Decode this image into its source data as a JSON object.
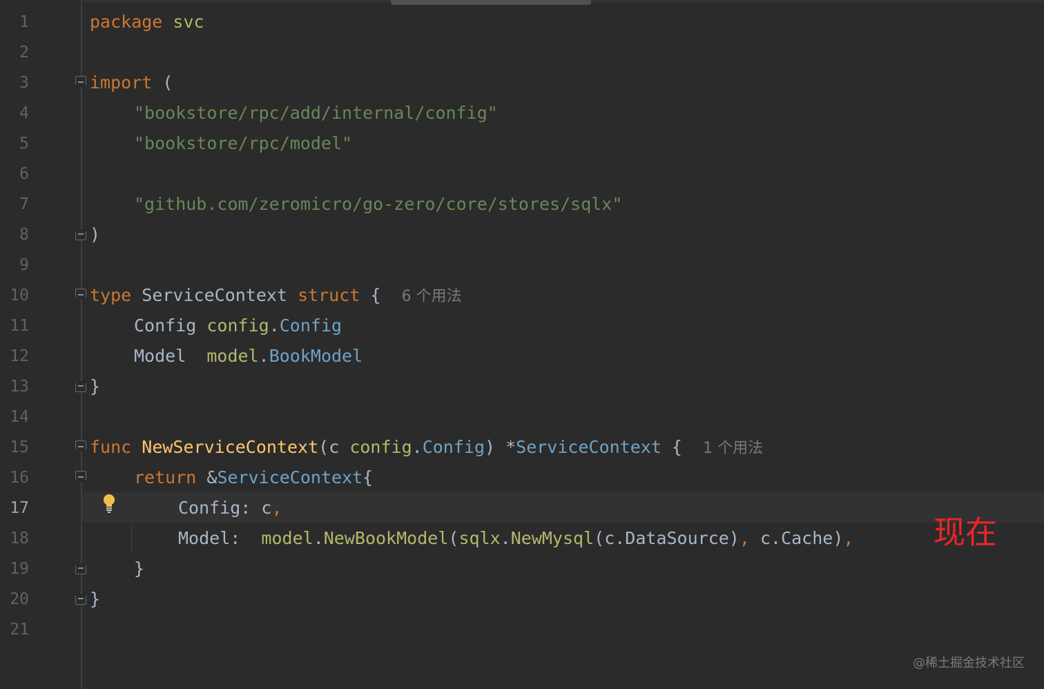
{
  "editor": {
    "line_numbers": [
      "1",
      "2",
      "3",
      "4",
      "5",
      "6",
      "7",
      "8",
      "9",
      "10",
      "11",
      "12",
      "13",
      "14",
      "15",
      "16",
      "17",
      "18",
      "19",
      "20",
      "21"
    ],
    "current_line": "17",
    "code": {
      "l1": {
        "kw": "package",
        "name": "svc"
      },
      "l3": {
        "kw": "import",
        "paren": "("
      },
      "l4": {
        "str": "\"bookstore/rpc/add/internal/config\""
      },
      "l5": {
        "str": "\"bookstore/rpc/model\""
      },
      "l7": {
        "str": "\"github.com/zeromicro/go-zero/core/stores/sqlx\""
      },
      "l8": {
        "paren": ")"
      },
      "l10": {
        "kw": "type",
        "name": "ServiceContext",
        "kw2": "struct",
        "brace": "{",
        "hint": "6 个用法"
      },
      "l11": {
        "field": "Config",
        "pkg": "config",
        "dot": ".",
        "type": "Config"
      },
      "l12": {
        "field": "Model ",
        "pkg": "model",
        "dot": ".",
        "type": "BookModel"
      },
      "l13": {
        "brace": "}"
      },
      "l15": {
        "kw": "func",
        "name": "NewServiceContext",
        "param": "(c ",
        "pkg": "config",
        "dot": ".",
        "type": "Config",
        "close": ") *",
        "ret": "ServiceContext",
        "brace": " {",
        "hint": "1 个用法"
      },
      "l16": {
        "kw": "return",
        "amp": "&",
        "type": "ServiceContext",
        "brace": "{"
      },
      "l17": {
        "field": "Config: c",
        "comma": ","
      },
      "l18": {
        "field": "Model:  ",
        "pkg": "model",
        "dot": ".",
        "fn": "NewBookModel",
        "p1": "(",
        "pkg2": "sqlx",
        "dot2": ".",
        "fn2": "NewMysql",
        "args": "(c.DataSource)",
        "comma": ",",
        "tail": " c.Cache)",
        "comma2": ","
      },
      "l19": {
        "brace": "}"
      },
      "l20": {
        "brace": "}"
      }
    }
  },
  "annotation": "现在",
  "watermark": "@稀土掘金技术社区",
  "colors": {
    "background": "#2b2b2b",
    "keyword": "#cc7832",
    "string": "#6a8759",
    "type": "#6fa3c7",
    "function": "#ffc66d",
    "annotation": "#e8262a"
  },
  "icons": [
    "lightbulb-icon",
    "fold-marker-icon"
  ]
}
